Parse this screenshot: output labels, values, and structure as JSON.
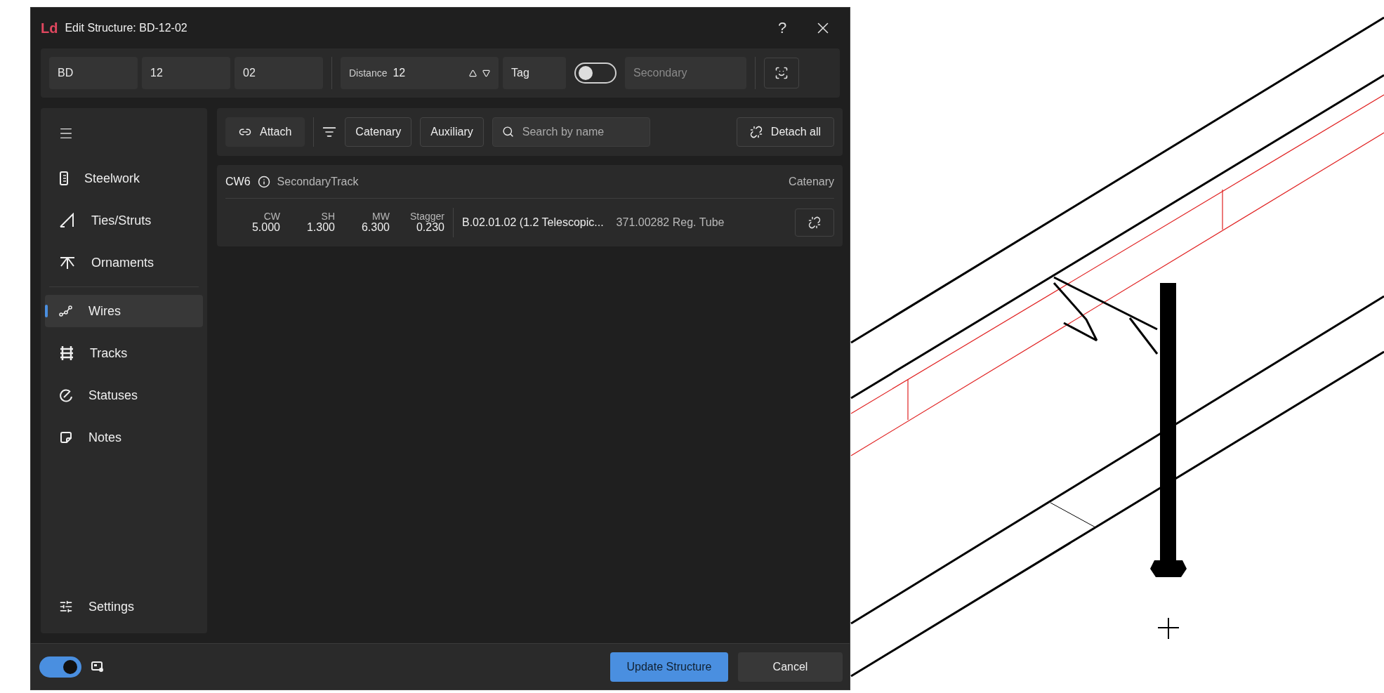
{
  "window": {
    "logo": "Ld",
    "title": "Edit Structure: BD-12-02",
    "help": "?"
  },
  "top_bar": {
    "fields": [
      {
        "value": "BD"
      },
      {
        "value": "12"
      },
      {
        "value": "02"
      }
    ],
    "distance": {
      "label": "Distance",
      "value": "12"
    },
    "tag": {
      "label": "Tag"
    },
    "secondary_toggle": {
      "on": false
    },
    "secondary": {
      "placeholder": "Secondary"
    }
  },
  "sidebar": {
    "groups": [
      [
        {
          "label": "Steelwork",
          "selected": false
        },
        {
          "label": "Ties/Struts",
          "selected": false
        },
        {
          "label": "Ornaments",
          "selected": false
        }
      ],
      [
        {
          "label": "Wires",
          "selected": true
        },
        {
          "label": "Tracks",
          "selected": false
        },
        {
          "label": "Statuses",
          "selected": false
        },
        {
          "label": "Notes",
          "selected": false
        }
      ]
    ],
    "footer_item": {
      "label": "Settings",
      "selected": false
    }
  },
  "toolbar": {
    "attach": "Attach",
    "filters": [
      "Catenary",
      "Auxiliary"
    ],
    "search": {
      "placeholder": "Search by name"
    },
    "detach_all": "Detach all"
  },
  "wires": [
    {
      "name": "CW6",
      "track": "SecondaryTrack",
      "type": "Catenary",
      "metrics": [
        {
          "label": "CW",
          "value": "5.000"
        },
        {
          "label": "SH",
          "value": "1.300"
        },
        {
          "label": "MW",
          "value": "6.300"
        },
        {
          "label": "Stagger",
          "value": "0.230"
        }
      ],
      "part": "B.02.01.02 (1.2 Telescopic...",
      "registration": "371.00282 Reg. Tube"
    }
  ],
  "footer": {
    "toggle": {
      "on": true
    },
    "primary": "Update Structure",
    "cancel": "Cancel"
  }
}
